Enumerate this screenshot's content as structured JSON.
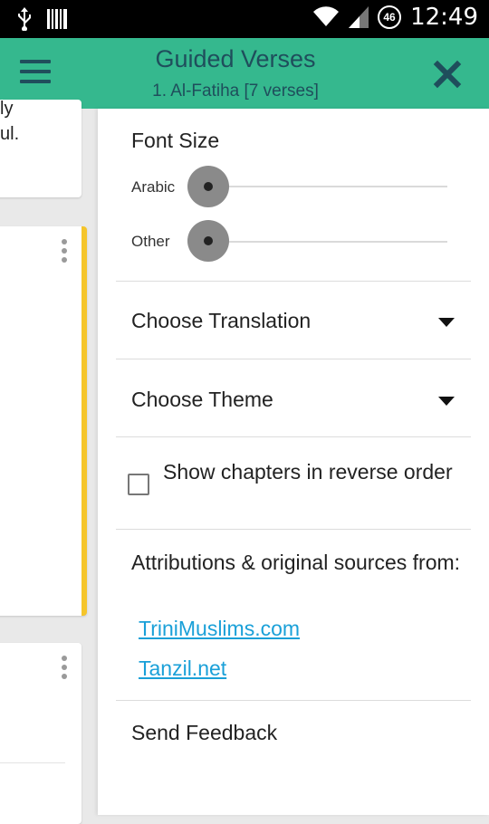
{
  "status_bar": {
    "time": "12:49",
    "network_badge": "46",
    "icons": [
      "usb-icon",
      "barcode-icon",
      "wifi-icon",
      "signal-icon"
    ]
  },
  "toolbar": {
    "title": "Guided Verses",
    "subtitle": "1. Al-Fatiha [7 verses]",
    "menu_icon": "hamburger-menu-icon",
    "close_icon": "close-icon",
    "background_color": "#35b88e",
    "text_color": "#1f4e5c"
  },
  "background": {
    "card1_text_line1": "ly",
    "card1_text_line2": "ul.",
    "highlight_color": "#f5c52b"
  },
  "panel": {
    "font_size": {
      "title": "Font Size",
      "arabic_label": "Arabic",
      "other_label": "Other",
      "arabic_value": 0,
      "other_value": 0
    },
    "translation": {
      "label": "Choose Translation"
    },
    "theme": {
      "label": "Choose Theme"
    },
    "reverse_order": {
      "label": "Show chapters in reverse order",
      "checked": false
    },
    "attributions": {
      "text": "Attributions & original sources from:",
      "links": [
        "TriniMuslims.com",
        "Tanzil.net"
      ],
      "link_color": "#1aa0d8"
    },
    "feedback": {
      "label": "Send Feedback"
    }
  }
}
